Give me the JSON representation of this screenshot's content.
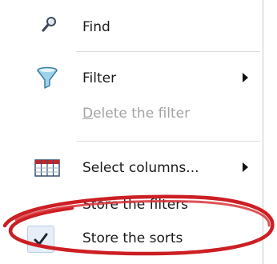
{
  "menu": {
    "items": [
      {
        "label": "Find",
        "icon": "magnifier-icon",
        "enabled": true,
        "submenu": false
      },
      {
        "label": "Filter",
        "icon": "funnel-icon",
        "enabled": true,
        "submenu": true
      },
      {
        "label_first": "D",
        "label_rest": "elete the filter",
        "icon": null,
        "enabled": false,
        "submenu": false
      },
      {
        "label": "Select columns...",
        "icon": "columns-icon",
        "enabled": true,
        "submenu": true
      },
      {
        "label": "Store the filters",
        "icon": null,
        "enabled": true,
        "submenu": false
      },
      {
        "label": "Store the sorts",
        "icon": "checkmark-icon",
        "enabled": true,
        "checked": true,
        "submenu": false
      }
    ]
  },
  "colors": {
    "highlight_ring": "#cc1f24",
    "disabled_text": "#a3a3a3",
    "check_bg": "#e7eef8"
  }
}
